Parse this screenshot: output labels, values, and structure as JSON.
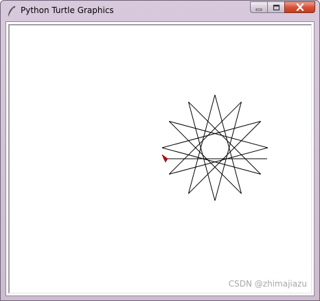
{
  "window": {
    "title": "Python Turtle Graphics"
  },
  "icons": {
    "app": "feather-icon",
    "minimize": "minimize-icon",
    "maximize": "maximize-icon",
    "close": "close-icon"
  },
  "canvas": {
    "stroke_color": "#000000",
    "turtle_color": "#cc0000"
  },
  "watermark": "CSDN @zhimajiazu"
}
